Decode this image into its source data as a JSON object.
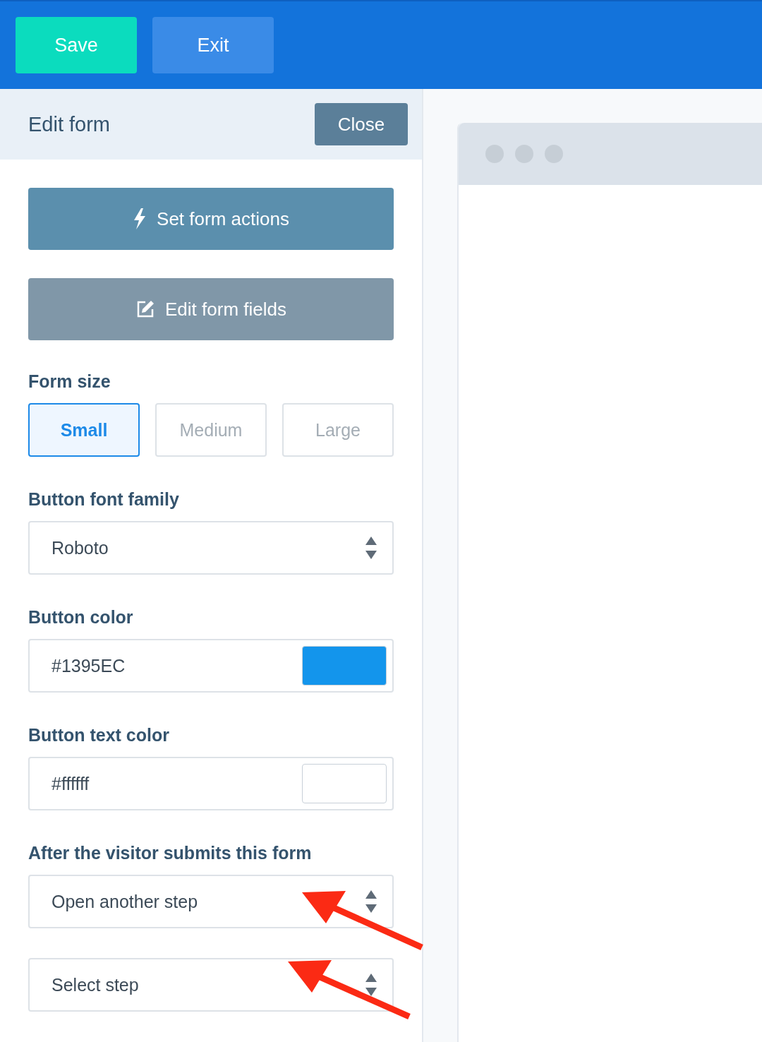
{
  "toolbar": {
    "buttons": [
      {
        "label": "Save",
        "kind": "primary"
      },
      {
        "label": "Exit",
        "kind": "secondary"
      }
    ]
  },
  "panel": {
    "title": "Edit form",
    "close_label": "Close",
    "actions": [
      {
        "label": "Set form actions",
        "kind": "bolt"
      },
      {
        "label": "Edit form fields",
        "kind": "edit"
      }
    ],
    "form_size": {
      "label": "Form size",
      "options": [
        {
          "label": "Small",
          "selected": true
        },
        {
          "label": "Medium",
          "selected": false
        },
        {
          "label": "Large",
          "selected": false
        }
      ]
    },
    "fields": [
      {
        "label": "Button font family",
        "kind": "select",
        "value": "Roboto"
      },
      {
        "label": "Button color",
        "kind": "color",
        "value": "#1395EC",
        "color": "#1395ec"
      },
      {
        "label": "Button text color",
        "kind": "color",
        "value": "#ffffff",
        "color": "#ffffff"
      },
      {
        "label": "After the visitor submits this form",
        "kind": "select",
        "value": "Open another step"
      },
      {
        "kind": "select",
        "value": "Select step"
      }
    ]
  }
}
